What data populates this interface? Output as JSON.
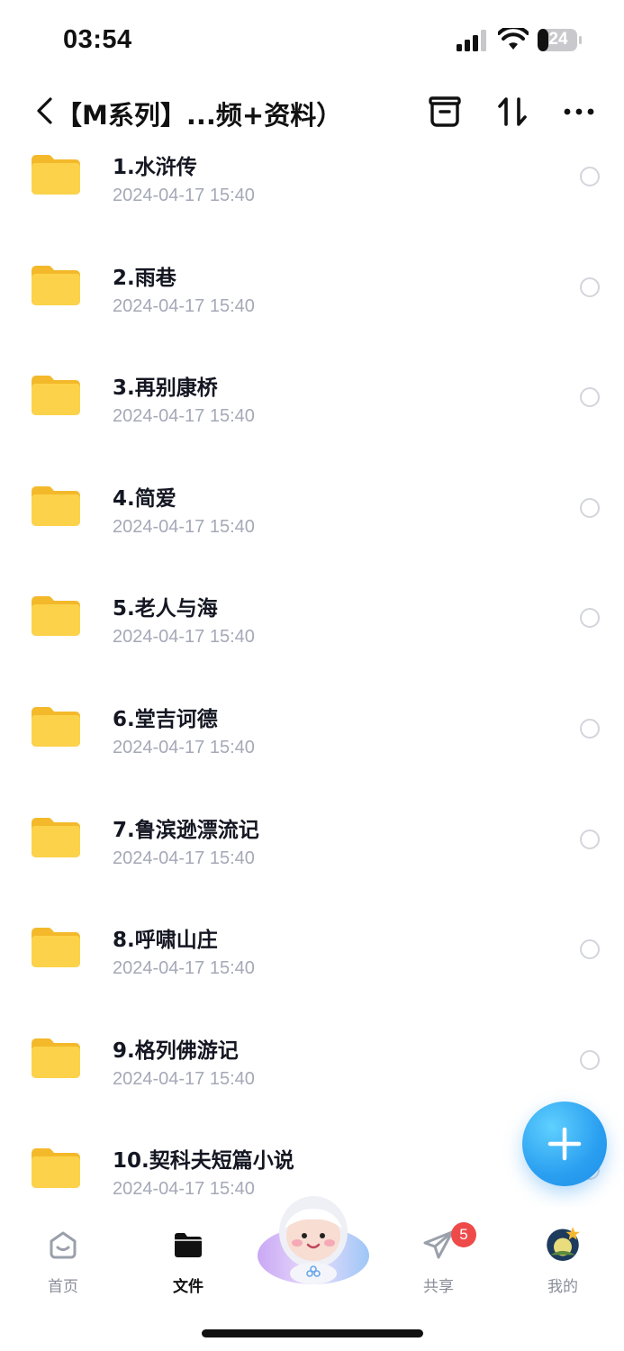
{
  "status": {
    "time": "03:54",
    "battery": "24"
  },
  "header": {
    "title": "【M系列】...频+资料）"
  },
  "files": [
    {
      "name": "1.水浒传",
      "date": "2024-04-17 15:40"
    },
    {
      "name": "2.雨巷",
      "date": "2024-04-17 15:40"
    },
    {
      "name": "3.再别康桥",
      "date": "2024-04-17 15:40"
    },
    {
      "name": "4.简爱",
      "date": "2024-04-17 15:40"
    },
    {
      "name": "5.老人与海",
      "date": "2024-04-17 15:40"
    },
    {
      "name": "6.堂吉诃德",
      "date": "2024-04-17 15:40"
    },
    {
      "name": "7.鲁滨逊漂流记",
      "date": "2024-04-17 15:40"
    },
    {
      "name": "8.呼啸山庄",
      "date": "2024-04-17 15:40"
    },
    {
      "name": "9.格列佛游记",
      "date": "2024-04-17 15:40"
    },
    {
      "name": "10.契科夫短篇小说",
      "date": "2024-04-17 15:40"
    }
  ],
  "tabs": {
    "home": "首页",
    "files": "文件",
    "share": "共享",
    "mine": "我的"
  },
  "share_badge": "5",
  "colors": {
    "accent": "#2a9ff0",
    "folder": "#f7c739",
    "badge": "#ee4a4a"
  }
}
